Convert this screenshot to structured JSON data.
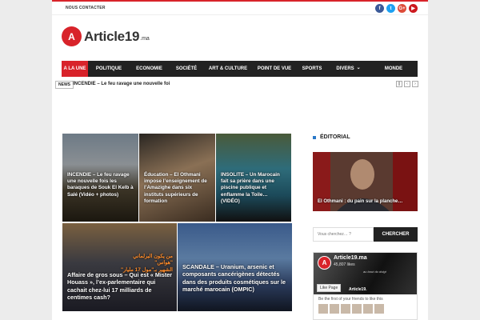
{
  "topbar": {
    "contact": "NOUS CONTACTER"
  },
  "social": [
    {
      "icon": "facebook-icon",
      "glyph": "f",
      "color": "#3b5998"
    },
    {
      "icon": "twitter-icon",
      "glyph": "t",
      "color": "#1da1f2"
    },
    {
      "icon": "google-plus-icon",
      "glyph": "G+",
      "color": "#dd4b39"
    },
    {
      "icon": "youtube-icon",
      "glyph": "▶",
      "color": "#cc181e"
    }
  ],
  "logo": {
    "badge": "A",
    "name": "Article19",
    "sub": ".ma"
  },
  "nav": [
    {
      "label": "A LA UNE",
      "active": true
    },
    {
      "label": "POLITIQUE"
    },
    {
      "label": "ECONOMIE"
    },
    {
      "label": "SOCIÉTÉ"
    },
    {
      "label": "ART & CULTURE"
    },
    {
      "label": "POINT DE VUE"
    },
    {
      "label": "SPORTS"
    },
    {
      "label": "DIVERS",
      "dropdown": true
    },
    {
      "label": "MONDE"
    }
  ],
  "ticker": {
    "label": "NEWS",
    "text": "INCENDIE – Le feu ravage une nouvelle foi",
    "controls": [
      "||",
      "‹",
      "›"
    ]
  },
  "tiles": [
    {
      "caption": "INCENDIE – Le feu ravage une nouvelle fois les baraques de Souk El Kelb à Salé (Vidéo + photos)"
    },
    {
      "caption": "Éducation – El Othmani impose l’enseignement de l’Amazighe dans six instituts supérieurs de formation"
    },
    {
      "caption": "INSOLITE – Un Marocain fait sa prière dans une piscine publique et enflamme la Toile… (VIDÉO)"
    },
    {
      "caption": "Affaire de gros sous – Qui est « Mister Houass », l’ex-parlementaire qui cachait chez-lui 17 milliards de centimes cash?",
      "overlay": [
        "من يكون البرلماني \"هواس\"",
        "الشهير بـ\"مول 17 مليار\""
      ]
    },
    {
      "caption": "SCANDALE – Uranium, arsenic et composants cancérigènes détectés dans des produits cosmétiques sur le marché marocain (OMPIC)"
    }
  ],
  "sidebar": {
    "editorial_title": "ÉDITORIAL",
    "editorial_caption": "El Othmani : du pain sur la planche…",
    "search_placeholder": "Vous cherchez… ?",
    "search_button": "CHERCHER",
    "fb": {
      "badge": "A",
      "name": "Article19.ma",
      "likes": "45,807 likes",
      "tagline": "au bout du doigt",
      "like_button": "Like Page",
      "mini_name": "Article19.",
      "first_text": "Be the first of your friends to like this"
    }
  }
}
